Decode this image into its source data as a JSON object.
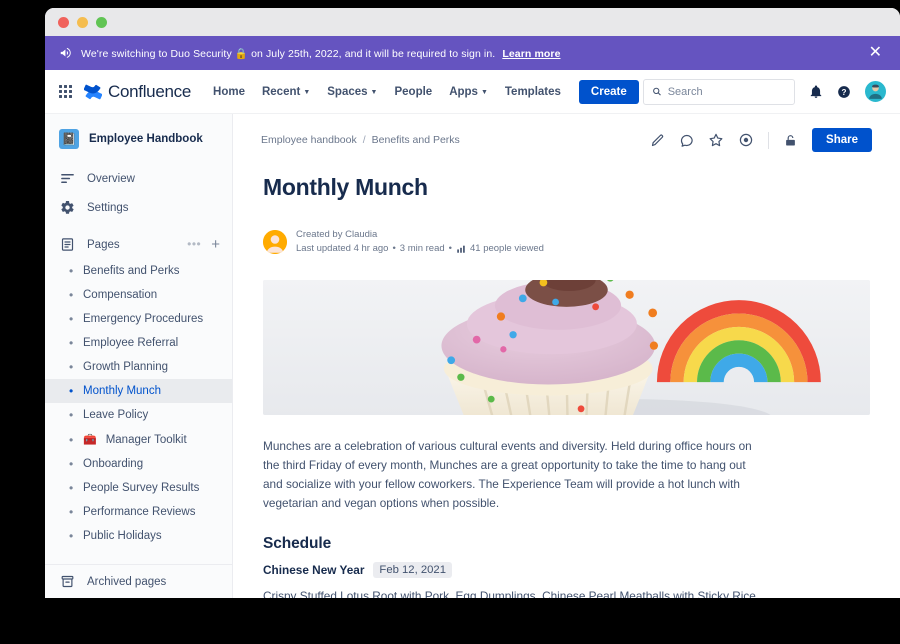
{
  "window": {
    "traffic_lights": [
      "close",
      "minimize",
      "maximize"
    ]
  },
  "banner": {
    "icon": "megaphone-icon",
    "text_before": "We're switching to Duo Security",
    "lock_emoji": "🔒",
    "text_after": "on July 25th, 2022, and it will be required to sign in.",
    "link_label": "Learn more",
    "close_label": "✕",
    "bg_color": "#6554c0"
  },
  "topnav": {
    "app_switcher": "grid-icon",
    "brand": "Confluence",
    "links": [
      {
        "label": "Home",
        "has_caret": false
      },
      {
        "label": "Recent",
        "has_caret": true
      },
      {
        "label": "Spaces",
        "has_caret": true
      },
      {
        "label": "People",
        "has_caret": false
      },
      {
        "label": "Apps",
        "has_caret": true
      },
      {
        "label": "Templates",
        "has_caret": false
      }
    ],
    "create_label": "Create",
    "search_placeholder": "Search",
    "search_value": "",
    "icons": [
      "notifications-icon",
      "help-icon",
      "profile-avatar"
    ],
    "primary_color": "#0052cc"
  },
  "sidebar": {
    "space_name": "Employee Handbook",
    "space_icon": "notebook-icon",
    "nav": [
      {
        "label": "Overview",
        "icon": "overview-icon"
      },
      {
        "label": "Settings",
        "icon": "gear-icon"
      }
    ],
    "pages_section": {
      "label": "Pages",
      "icon": "pages-icon",
      "more_label": "•••",
      "add_label": "+"
    },
    "pages": [
      {
        "label": "Benefits and Perks",
        "active": false,
        "emoji": ""
      },
      {
        "label": "Compensation",
        "active": false,
        "emoji": ""
      },
      {
        "label": "Emergency Procedures",
        "active": false,
        "emoji": ""
      },
      {
        "label": "Employee Referral",
        "active": false,
        "emoji": ""
      },
      {
        "label": "Growth Planning",
        "active": false,
        "emoji": ""
      },
      {
        "label": "Monthly Munch",
        "active": true,
        "emoji": ""
      },
      {
        "label": "Leave Policy",
        "active": false,
        "emoji": ""
      },
      {
        "label": "Manager Toolkit",
        "active": false,
        "emoji": "🧰"
      },
      {
        "label": "Onboarding",
        "active": false,
        "emoji": ""
      },
      {
        "label": "People Survey Results",
        "active": false,
        "emoji": ""
      },
      {
        "label": "Performance Reviews",
        "active": false,
        "emoji": ""
      },
      {
        "label": "Public Holidays",
        "active": false,
        "emoji": ""
      }
    ],
    "archived_label": "Archived pages",
    "archived_icon": "archive-icon"
  },
  "content": {
    "breadcrumb": [
      {
        "label": "Employee handbook"
      },
      {
        "label": "Benefits and Perks"
      }
    ],
    "breadcrumb_separator": "/",
    "actions": [
      "edit-pencil-icon",
      "comment-icon",
      "star-icon",
      "watch-eye-icon",
      "restrictions-lock-icon"
    ],
    "share_label": "Share",
    "title": "Monthly Munch",
    "meta": {
      "created_by": "Created by Claudia",
      "last_updated": "Last updated 4 hr ago",
      "read_time": "3 min read",
      "views_icon": "analytics-icon",
      "views": "41 people viewed",
      "separator": "•"
    },
    "hero_image_alt": "cupcake-with-rainbow-photo",
    "paragraph": "Munches are a celebration of various cultural events and diversity. Held during office hours on the third Friday of every month, Munches are a great opportunity to take the time to hang out and socialize with your fellow coworkers. The Experience Team will provide a hot lunch with vegetarian and vegan options when possible.",
    "schedule_heading": "Schedule",
    "event_name": "Chinese New Year",
    "event_date": "Feb 12, 2021",
    "event_description": "Crispy Stuffed Lotus Root with Pork, Egg Dumplings, Chinese Pearl Meatballs with Sticky Rice, Taro Cake, Soy Sauce Chicken, Vegetable Dumplings, Braised Glass Noodles with Napa Cabbage"
  }
}
